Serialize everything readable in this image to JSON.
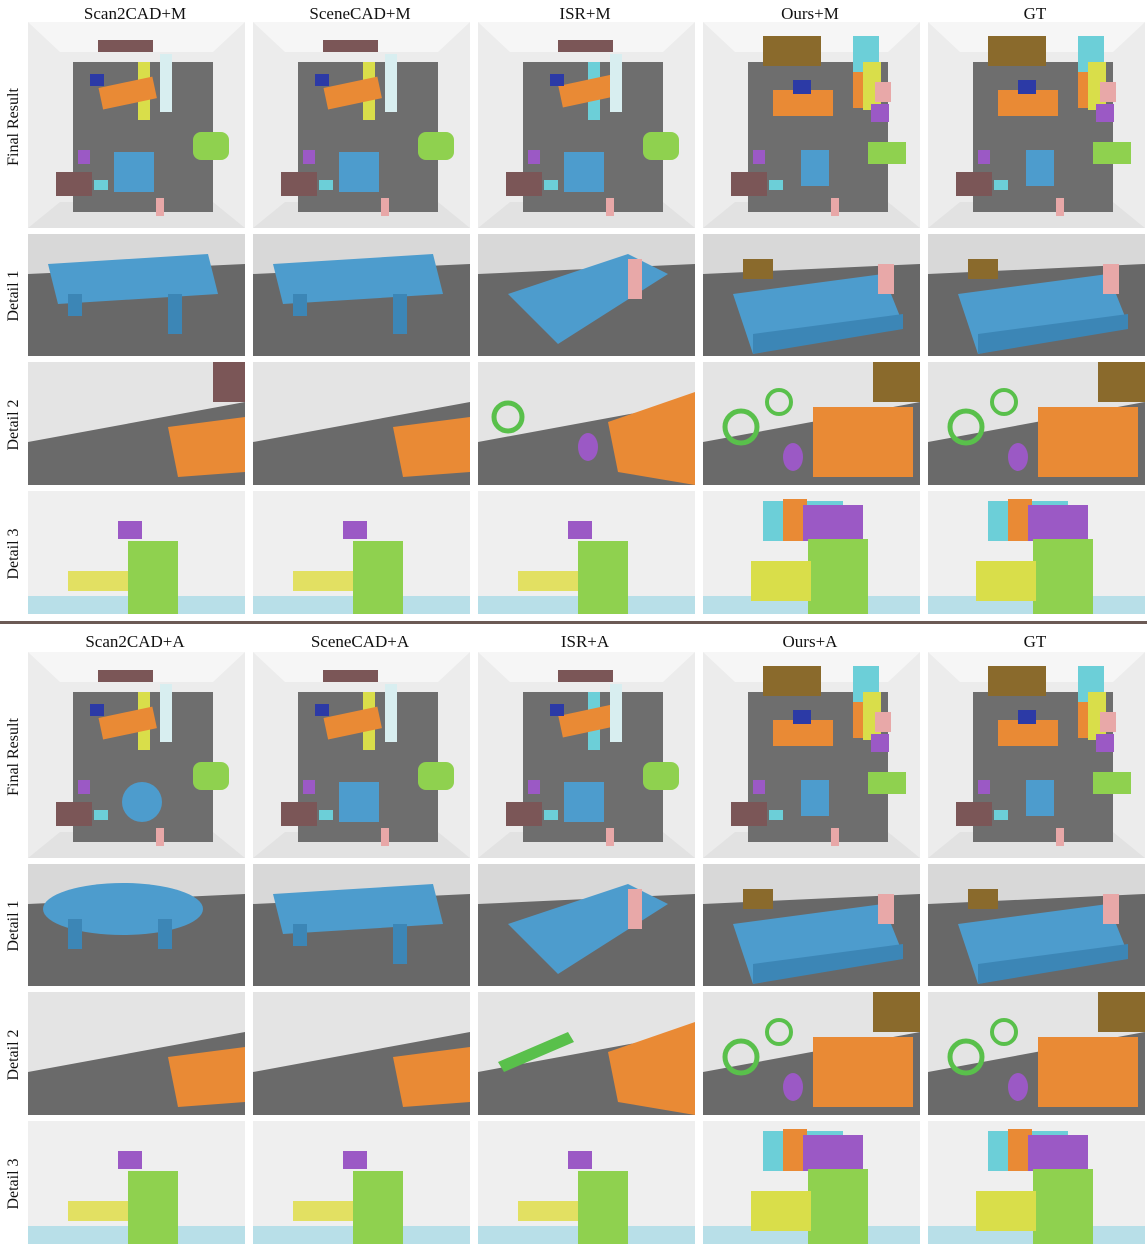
{
  "sections": [
    {
      "columns": [
        "Scan2CAD+M",
        "SceneCAD+M",
        "ISR+M",
        "Ours+M",
        "GT"
      ],
      "rows": [
        "Final Result",
        "Detail 1",
        "Detail 2",
        "Detail 3"
      ]
    },
    {
      "columns": [
        "Scan2CAD+A",
        "SceneCAD+A",
        "ISR+A",
        "Ours+A",
        "GT"
      ],
      "rows": [
        "Final Result",
        "Detail 1",
        "Detail 2",
        "Detail 3"
      ]
    }
  ],
  "colors": {
    "floor": "#6e6e6e",
    "bed": "#4d9ccd",
    "sofa": "#e98a35",
    "cabinet": "#8fd14f",
    "wardrobe": "#d9de4a",
    "bench": "#e2e062",
    "shelf": "#7b5657",
    "nightstand": "#e8a8a8",
    "purple": "#9b59c5",
    "bike": "#59c04b",
    "teal": "#6ccfd8",
    "navy": "#2c3aa6",
    "wood": "#8a6a2c",
    "divider": "#6b5a55"
  }
}
